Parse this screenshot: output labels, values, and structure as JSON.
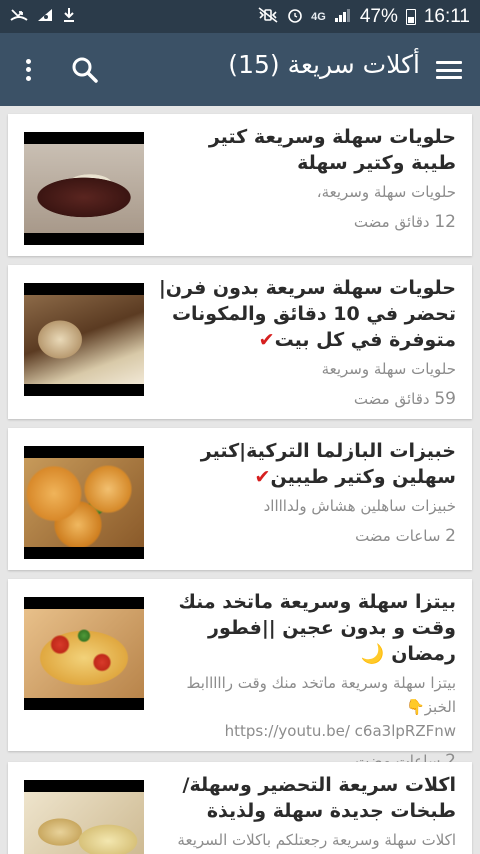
{
  "status_bar": {
    "battery": "47%",
    "time": "16:11",
    "network": "4G",
    "left_icons": [
      "missed-call-icon",
      "signal-app-icon",
      "download-icon"
    ],
    "right_icons": [
      "mute-icon",
      "alarm-icon",
      "network-icon",
      "signal-icon",
      "battery-icon"
    ]
  },
  "app_bar": {
    "title": "أكلات سريعة (15)",
    "icons": [
      "menu-icon",
      "search-icon",
      "more-vert-icon"
    ]
  },
  "feed": [
    {
      "title": "حلويات سهلة وسريعة كتير طيبة وكتير سهلة",
      "title_mark": "",
      "desc": "حلويات سهلة وسريعة،",
      "desc_extra": "",
      "time_num": "12",
      "time_unit": "دقائق مضت"
    },
    {
      "title": "حلويات سهلة سريعة بدون فرن|تحضر في 10 دقائق والمكونات متوفرة في كل بيت",
      "title_mark": "✔",
      "desc": "حلويات سهلة وسريعة",
      "desc_extra": "",
      "time_num": "59",
      "time_unit": "دقائق مضت"
    },
    {
      "title": "خبيزات البازلما التركية|كتير سهلين وكتير طيبين",
      "title_mark": "✔",
      "desc": "خبيزات ساهلين هشاش ولدااااد",
      "desc_extra": "",
      "time_num": "2",
      "time_unit": "ساعات مضت"
    },
    {
      "title": "بيتزا سهلة وسريعة ماتخد منك وقت و بدون عجين ||فطور رمضان",
      "title_mark": "🌙",
      "desc": "بيتزا سهلة وسريعة ماتخد منك وقت رااااابط الخبز👇",
      "desc_extra": "https://youtu.be/ c6a3lpRZFnw",
      "time_num": "2",
      "time_unit": "ساعات مضت"
    },
    {
      "title": "اكلات سريعة التحضير وسهلة/طبخات جديدة سهلة ولذيذة",
      "title_mark": "",
      "desc": "اكلات سهلة وسريعة رجعتلكم باكلات السريعة",
      "desc_extra": "",
      "time_num": "",
      "time_unit": ""
    }
  ]
}
